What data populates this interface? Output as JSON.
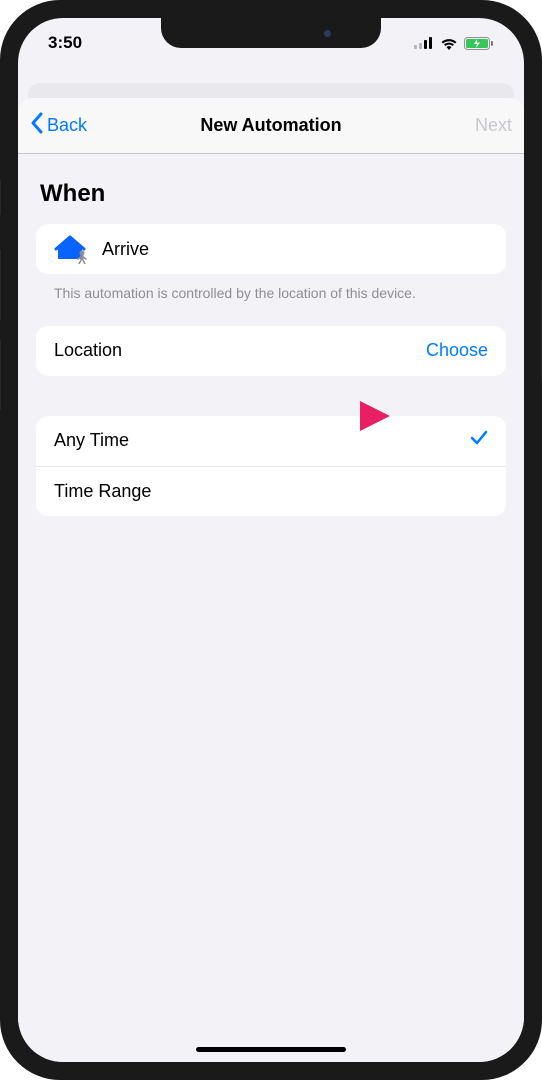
{
  "status_bar": {
    "time": "3:50"
  },
  "nav": {
    "back_label": "Back",
    "title": "New Automation",
    "next_label": "Next"
  },
  "section_title": "When",
  "arrive": {
    "label": "Arrive"
  },
  "footnote": "This automation is controlled by the location of this device.",
  "location": {
    "label": "Location",
    "action": "Choose"
  },
  "time_options": {
    "any_time": "Any Time",
    "time_range": "Time Range"
  }
}
